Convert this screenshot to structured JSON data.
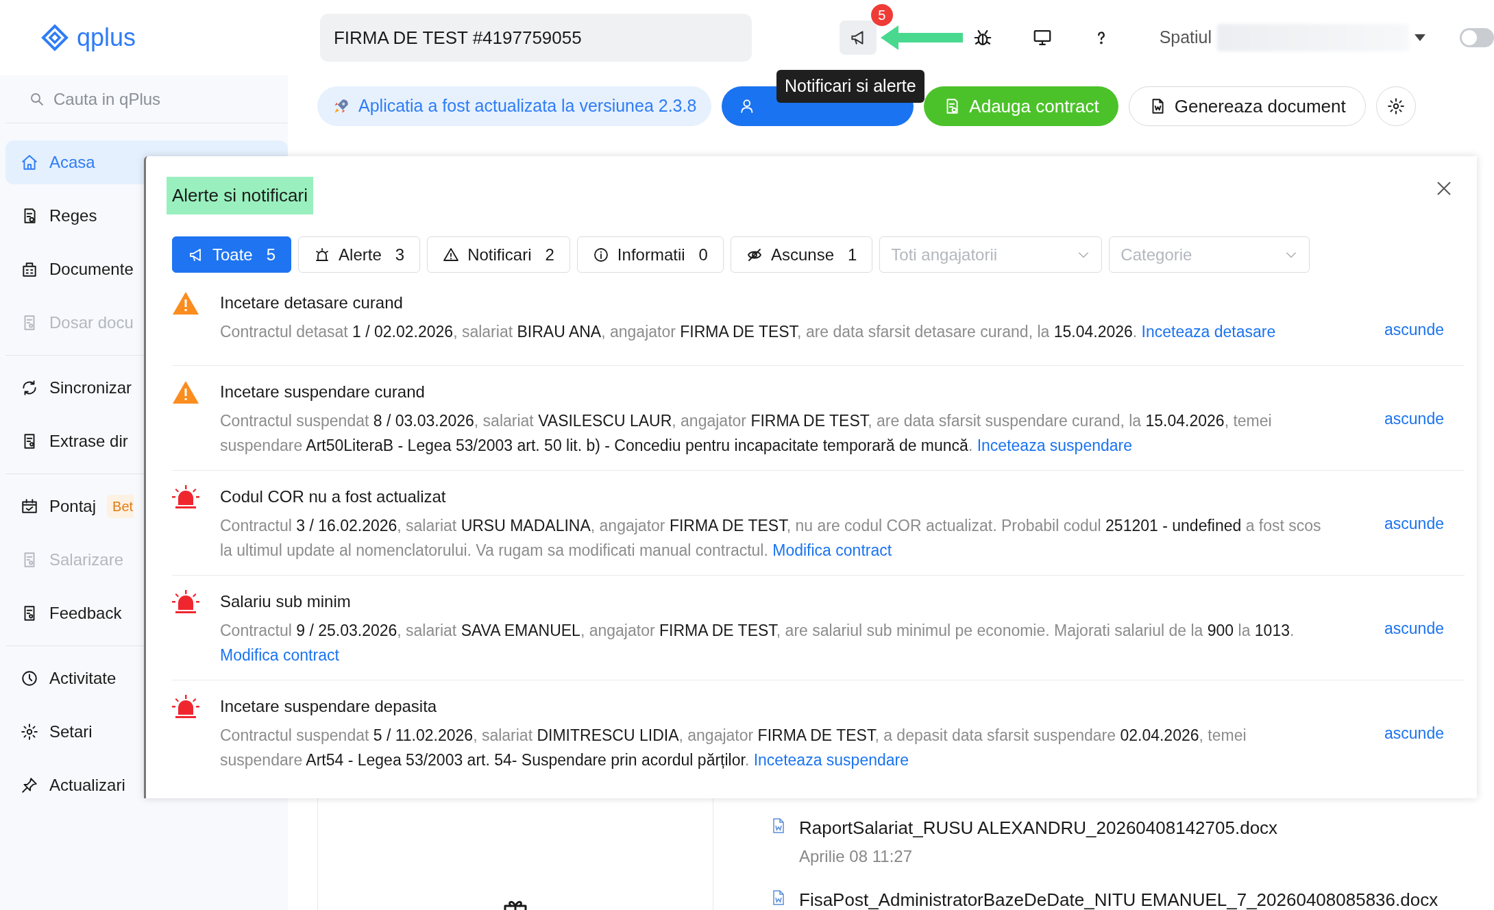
{
  "header": {
    "logo": "qplus",
    "company": "FIRMA DE TEST #4197759055",
    "notifications_badge": "5",
    "tooltip": "Notificari si alerte",
    "workspace_label": "Spatiul",
    "theme_toggle_on": false
  },
  "sidebar": {
    "search_placeholder": "Cauta in qPlus",
    "groups": [
      [
        {
          "label": "Acasa",
          "selected": true,
          "disabled": false
        },
        {
          "label": "Reges",
          "selected": false,
          "disabled": false
        },
        {
          "label": "Documente",
          "selected": false,
          "disabled": false
        },
        {
          "label": "Dosar docu",
          "selected": false,
          "disabled": true
        }
      ],
      [
        {
          "label": "Sincronizar",
          "selected": false,
          "disabled": false
        },
        {
          "label": "Extrase dir",
          "selected": false,
          "disabled": false
        }
      ],
      [
        {
          "label": "Pontaj",
          "badge": "Bet",
          "selected": false,
          "disabled": false
        },
        {
          "label": "Salarizare",
          "selected": false,
          "disabled": true
        },
        {
          "label": "Feedback",
          "selected": false,
          "disabled": false
        }
      ],
      [
        {
          "label": "Activitate",
          "selected": false,
          "disabled": false
        },
        {
          "label": "Setari",
          "selected": false,
          "disabled": false
        },
        {
          "label": "Actualizari",
          "selected": false,
          "disabled": false
        }
      ]
    ]
  },
  "toolbar": {
    "update_banner": "Aplicatia a fost actualizata la versiunea 2.3.8",
    "buttons": [
      {
        "kind": "primary"
      },
      {
        "kind": "success",
        "label": "Adauga contract"
      },
      {
        "kind": "outline",
        "label": "Genereaza document"
      },
      {
        "kind": "icon"
      }
    ]
  },
  "modal": {
    "title": "Alerte si notificari",
    "tabs": [
      {
        "label": "Toate",
        "count": "5",
        "selected": true
      },
      {
        "label": "Alerte",
        "count": "3",
        "selected": false
      },
      {
        "label": "Notificari",
        "count": "2",
        "selected": false
      },
      {
        "label": "Informatii",
        "count": "0",
        "selected": false
      },
      {
        "label": "Ascunse",
        "count": "1",
        "selected": false
      }
    ],
    "filters": [
      {
        "placeholder": "Toti angajatorii"
      },
      {
        "placeholder": "Categorie"
      }
    ],
    "alerts": [
      {
        "kind": "warning",
        "title": "Incetare detasare curand",
        "message": "Contractul detasat **1 / 02.02.2026**, salariat **BIRAU ANA**, angajator **FIRMA DE TEST**, are data sfarsit detasare curand, la **15.04.2026**.",
        "action": "Inceteaza detasare",
        "hide": "ascunde"
      },
      {
        "kind": "warning",
        "title": "Incetare suspendare curand",
        "message": "Contractul suspendat **8 / 03.03.2026**, salariat **VASILESCU LAUR**, angajator **FIRMA DE TEST**, are data sfarsit suspendare curand, la **15.04.2026**, temei suspendare **Art50LiteraB - Legea 53/2003 art. 50 lit. b) - Concediu pentru incapacitate temporară de muncă**.",
        "action": "Inceteaza suspendare",
        "hide": "ascunde"
      },
      {
        "kind": "alarm",
        "title": "Codul COR nu a fost actualizat",
        "message": "Contractul **3 / 16.02.2026**, salariat **URSU MADALINA**, angajator **FIRMA DE TEST**, nu are codul COR actualizat. Probabil codul **251201 - undefined** a fost scos la ultimul update al nomenclatorului. Va rugam sa modificati manual contractul.",
        "action": "Modifica contract",
        "hide": "ascunde"
      },
      {
        "kind": "alarm",
        "title": "Salariu sub minim",
        "message": "Contractul **9 / 25.03.2026**, salariat **SAVA EMANUEL**, angajator **FIRMA DE TEST**, are salariul sub minimul pe economie. Majorati salariul de la **900** la **1013**.",
        "action": "Modifica contract",
        "hide": "ascunde"
      },
      {
        "kind": "alarm",
        "title": "Incetare suspendare depasita",
        "message": "Contractul suspendat **5 / 11.02.2026**, salariat **DIMITRESCU LIDIA**, angajator **FIRMA DE TEST**, a depasit data sfarsit suspendare **02.04.2026**, temei suspendare **Art54 - Legea 53/2003 art. 54- Suspendare prin acordul părților**.",
        "action": "Inceteaza suspendare",
        "hide": "ascunde"
      }
    ]
  },
  "recent_documents": [
    {
      "name": "RaportSalariat_RUSU ALEXANDRU_20260408142705.docx",
      "date": "Aprilie 08 11:27"
    },
    {
      "name": "FisaPost_AdministratorBazeDeDate_NITU EMANUEL_7_20260408085836.docx"
    }
  ]
}
